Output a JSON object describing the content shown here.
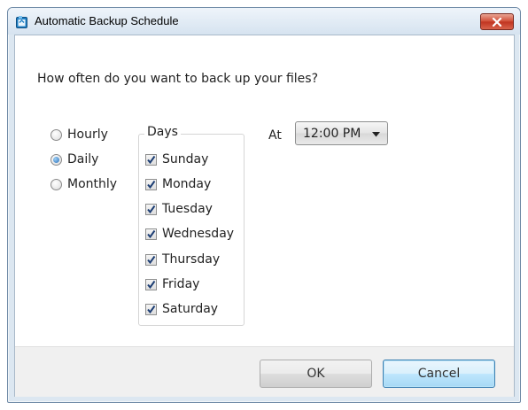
{
  "window": {
    "title": "Automatic Backup Schedule",
    "accent": "#2a6fb8",
    "close_color": "#c0331f"
  },
  "prompt": "How often do you want to back up your files?",
  "frequency": {
    "options": [
      {
        "label": "Hourly",
        "selected": false
      },
      {
        "label": "Daily",
        "selected": true
      },
      {
        "label": "Monthly",
        "selected": false
      }
    ]
  },
  "days": {
    "legend": "Days",
    "items": [
      {
        "label": "Sunday",
        "checked": true
      },
      {
        "label": "Monday",
        "checked": true
      },
      {
        "label": "Tuesday",
        "checked": true
      },
      {
        "label": "Wednesday",
        "checked": true
      },
      {
        "label": "Thursday",
        "checked": true
      },
      {
        "label": "Friday",
        "checked": true
      },
      {
        "label": "Saturday",
        "checked": true
      }
    ]
  },
  "time": {
    "label": "At",
    "value": "12:00 PM"
  },
  "buttons": {
    "ok": "OK",
    "cancel": "Cancel"
  }
}
